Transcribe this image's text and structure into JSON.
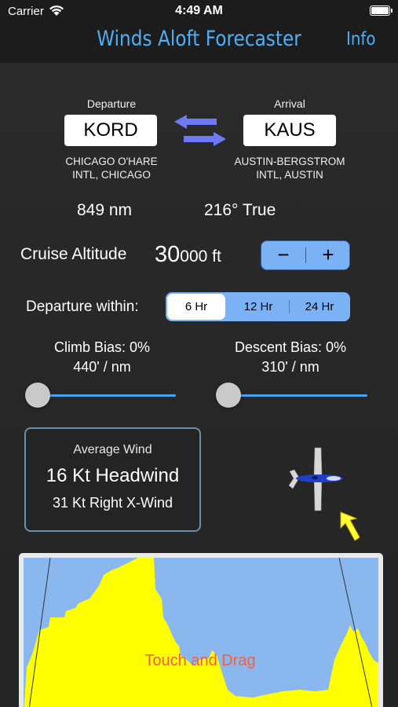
{
  "status": {
    "carrier": "Carrier",
    "time": "4:49 AM"
  },
  "nav": {
    "title": "Winds Aloft Forecaster",
    "info": "Info"
  },
  "departure": {
    "heading": "Departure",
    "code": "KORD",
    "name_line1": "CHICAGO O'HARE",
    "name_line2": "INTL, CHICAGO"
  },
  "arrival": {
    "heading": "Arrival",
    "code": "KAUS",
    "name_line1": "AUSTIN-BERGSTROM",
    "name_line2": "INTL, AUSTIN"
  },
  "route": {
    "distance": "849  nm",
    "course": "216°  True"
  },
  "cruise": {
    "label": "Cruise Altitude",
    "value_big": "30",
    "value_small": "000 ft",
    "minus": "−",
    "plus": "+"
  },
  "departure_within": {
    "label": "Departure within:",
    "options": [
      "6 Hr",
      "12 Hr",
      "24 Hr"
    ],
    "selected": "6 Hr"
  },
  "climb": {
    "label": "Climb Bias:  0%",
    "rate": "440' / nm",
    "slider_value": 0
  },
  "descent": {
    "label": "Descent Bias:  0%",
    "rate": "310' / nm",
    "slider_value": 0
  },
  "wind": {
    "heading": "Average Wind",
    "headwind": "16 Kt Headwind",
    "crosswind": "31 Kt Right X-Wind"
  },
  "profile": {
    "hint": "Touch and Drag"
  },
  "colors": {
    "accent": "#4faff5",
    "control": "#7ab2f5",
    "sky": "#8ab8ee",
    "wind_fill": "#ffff00",
    "hint": "#f06040"
  }
}
